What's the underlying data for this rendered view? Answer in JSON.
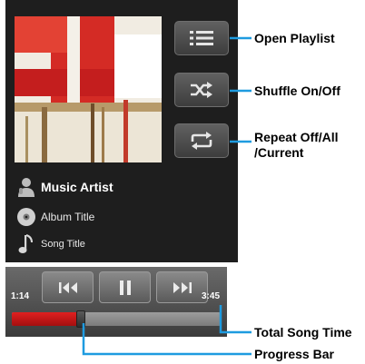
{
  "now_playing": {
    "artist": "Music Artist",
    "album": "Album Title",
    "song": "Song Title"
  },
  "side_buttons": {
    "playlist_icon": "list-icon",
    "shuffle_icon": "shuffle-icon",
    "repeat_icon": "repeat-icon"
  },
  "controls": {
    "elapsed": "1:14",
    "total": "3:45",
    "progress_fraction": 0.33
  },
  "callouts": {
    "open_playlist": "Open Playlist",
    "shuffle": "Shuffle On/Off",
    "repeat_line1": "Repeat Off/All",
    "repeat_line2": "/Current",
    "total_time": "Total Song Time",
    "progress_bar": "Progress Bar"
  },
  "colors": {
    "callout_line": "#1e9be0",
    "progress_fill": "#cc1a1a"
  }
}
